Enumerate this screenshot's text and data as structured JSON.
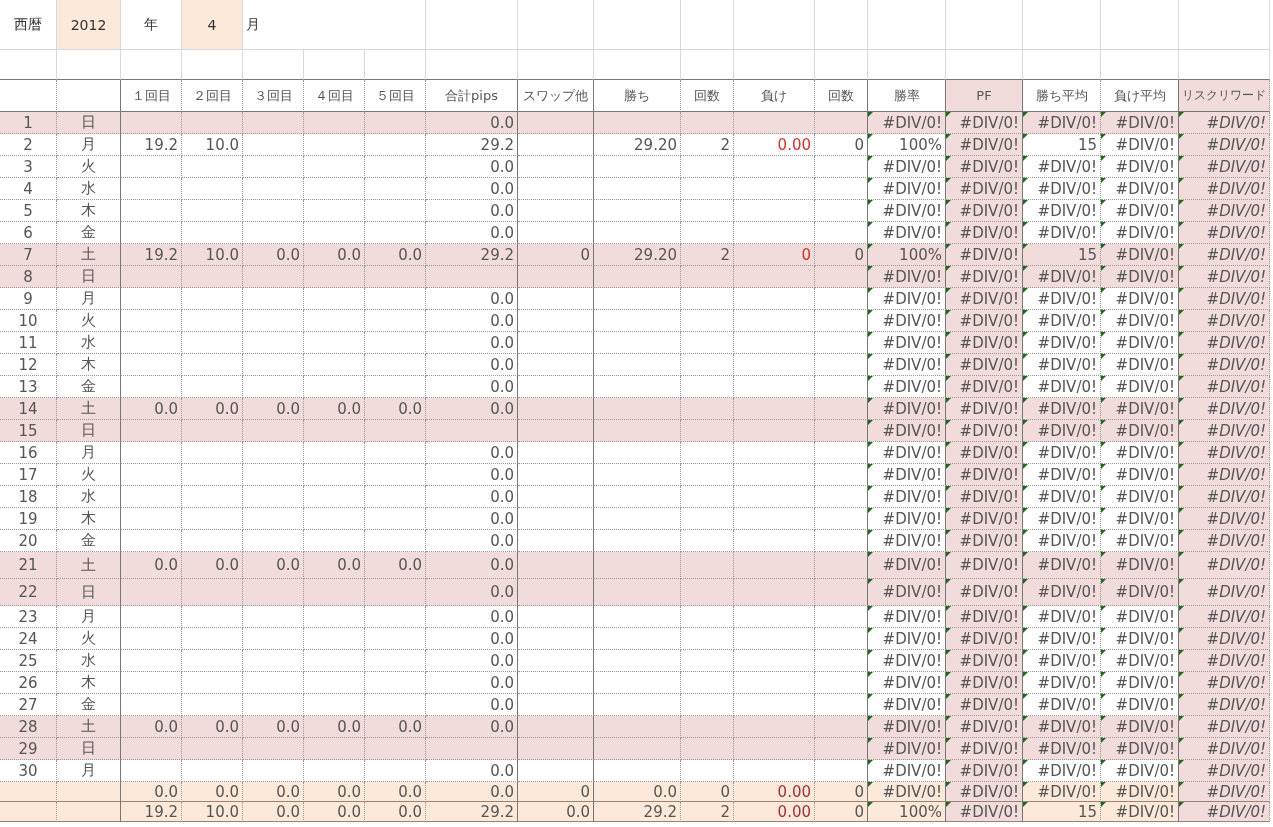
{
  "top": {
    "era_label": "西暦",
    "year": "2012",
    "year_label": "年",
    "month": "4",
    "month_label": "月"
  },
  "columns": [
    "",
    "",
    "１回目",
    "２回目",
    "３回目",
    "４回目",
    "５回目",
    "合計pips",
    "スワップ他",
    "勝ち",
    "回数",
    "負け",
    "回数",
    "勝率",
    "PF",
    "勝ち平均",
    "負け平均",
    "リスクリワード"
  ],
  "rows": [
    {
      "day": "1",
      "weekday": "日",
      "weekend": true,
      "cells": [
        "",
        "",
        "",
        "",
        "",
        "0.0",
        "",
        "",
        "",
        "",
        "",
        "#DIV/0!",
        "#DIV/0!",
        "#DIV/0!",
        "#DIV/0!",
        "#DIV/0!"
      ]
    },
    {
      "day": "2",
      "weekday": "月",
      "weekend": false,
      "cells": [
        "19.2",
        "10.0",
        "",
        "",
        "",
        "29.2",
        "",
        "29.20",
        "2",
        "0.00",
        "0",
        "100%",
        "#DIV/0!",
        "15",
        "#DIV/0!",
        "#DIV/0!"
      ]
    },
    {
      "day": "3",
      "weekday": "火",
      "weekend": false,
      "cells": [
        "",
        "",
        "",
        "",
        "",
        "0.0",
        "",
        "",
        "",
        "",
        "",
        "#DIV/0!",
        "#DIV/0!",
        "#DIV/0!",
        "#DIV/0!",
        "#DIV/0!"
      ]
    },
    {
      "day": "4",
      "weekday": "水",
      "weekend": false,
      "cells": [
        "",
        "",
        "",
        "",
        "",
        "0.0",
        "",
        "",
        "",
        "",
        "",
        "#DIV/0!",
        "#DIV/0!",
        "#DIV/0!",
        "#DIV/0!",
        "#DIV/0!"
      ]
    },
    {
      "day": "5",
      "weekday": "木",
      "weekend": false,
      "cells": [
        "",
        "",
        "",
        "",
        "",
        "0.0",
        "",
        "",
        "",
        "",
        "",
        "#DIV/0!",
        "#DIV/0!",
        "#DIV/0!",
        "#DIV/0!",
        "#DIV/0!"
      ]
    },
    {
      "day": "6",
      "weekday": "金",
      "weekend": false,
      "cells": [
        "",
        "",
        "",
        "",
        "",
        "0.0",
        "",
        "",
        "",
        "",
        "",
        "#DIV/0!",
        "#DIV/0!",
        "#DIV/0!",
        "#DIV/0!",
        "#DIV/0!"
      ]
    },
    {
      "day": "7",
      "weekday": "土",
      "weekend": true,
      "cells": [
        "19.2",
        "10.0",
        "0.0",
        "0.0",
        "0.0",
        "29.2",
        "0",
        "29.20",
        "2",
        "0",
        "0",
        "100%",
        "#DIV/0!",
        "15",
        "#DIV/0!",
        "#DIV/0!"
      ]
    },
    {
      "day": "8",
      "weekday": "日",
      "weekend": true,
      "cells": [
        "",
        "",
        "",
        "",
        "",
        "",
        "",
        "",
        "",
        "",
        "",
        "#DIV/0!",
        "#DIV/0!",
        "#DIV/0!",
        "#DIV/0!",
        "#DIV/0!"
      ]
    },
    {
      "day": "9",
      "weekday": "月",
      "weekend": false,
      "cells": [
        "",
        "",
        "",
        "",
        "",
        "0.0",
        "",
        "",
        "",
        "",
        "",
        "#DIV/0!",
        "#DIV/0!",
        "#DIV/0!",
        "#DIV/0!",
        "#DIV/0!"
      ]
    },
    {
      "day": "10",
      "weekday": "火",
      "weekend": false,
      "cells": [
        "",
        "",
        "",
        "",
        "",
        "0.0",
        "",
        "",
        "",
        "",
        "",
        "#DIV/0!",
        "#DIV/0!",
        "#DIV/0!",
        "#DIV/0!",
        "#DIV/0!"
      ]
    },
    {
      "day": "11",
      "weekday": "水",
      "weekend": false,
      "cells": [
        "",
        "",
        "",
        "",
        "",
        "0.0",
        "",
        "",
        "",
        "",
        "",
        "#DIV/0!",
        "#DIV/0!",
        "#DIV/0!",
        "#DIV/0!",
        "#DIV/0!"
      ]
    },
    {
      "day": "12",
      "weekday": "木",
      "weekend": false,
      "cells": [
        "",
        "",
        "",
        "",
        "",
        "0.0",
        "",
        "",
        "",
        "",
        "",
        "#DIV/0!",
        "#DIV/0!",
        "#DIV/0!",
        "#DIV/0!",
        "#DIV/0!"
      ]
    },
    {
      "day": "13",
      "weekday": "金",
      "weekend": false,
      "cells": [
        "",
        "",
        "",
        "",
        "",
        "0.0",
        "",
        "",
        "",
        "",
        "",
        "#DIV/0!",
        "#DIV/0!",
        "#DIV/0!",
        "#DIV/0!",
        "#DIV/0!"
      ]
    },
    {
      "day": "14",
      "weekday": "土",
      "weekend": true,
      "cells": [
        "0.0",
        "0.0",
        "0.0",
        "0.0",
        "0.0",
        "0.0",
        "",
        "",
        "",
        "",
        "",
        "#DIV/0!",
        "#DIV/0!",
        "#DIV/0!",
        "#DIV/0!",
        "#DIV/0!"
      ]
    },
    {
      "day": "15",
      "weekday": "日",
      "weekend": true,
      "cells": [
        "",
        "",
        "",
        "",
        "",
        "",
        "",
        "",
        "",
        "",
        "",
        "#DIV/0!",
        "#DIV/0!",
        "#DIV/0!",
        "#DIV/0!",
        "#DIV/0!"
      ]
    },
    {
      "day": "16",
      "weekday": "月",
      "weekend": false,
      "cells": [
        "",
        "",
        "",
        "",
        "",
        "0.0",
        "",
        "",
        "",
        "",
        "",
        "#DIV/0!",
        "#DIV/0!",
        "#DIV/0!",
        "#DIV/0!",
        "#DIV/0!"
      ]
    },
    {
      "day": "17",
      "weekday": "火",
      "weekend": false,
      "cells": [
        "",
        "",
        "",
        "",
        "",
        "0.0",
        "",
        "",
        "",
        "",
        "",
        "#DIV/0!",
        "#DIV/0!",
        "#DIV/0!",
        "#DIV/0!",
        "#DIV/0!"
      ]
    },
    {
      "day": "18",
      "weekday": "水",
      "weekend": false,
      "cells": [
        "",
        "",
        "",
        "",
        "",
        "0.0",
        "",
        "",
        "",
        "",
        "",
        "#DIV/0!",
        "#DIV/0!",
        "#DIV/0!",
        "#DIV/0!",
        "#DIV/0!"
      ]
    },
    {
      "day": "19",
      "weekday": "木",
      "weekend": false,
      "cells": [
        "",
        "",
        "",
        "",
        "",
        "0.0",
        "",
        "",
        "",
        "",
        "",
        "#DIV/0!",
        "#DIV/0!",
        "#DIV/0!",
        "#DIV/0!",
        "#DIV/0!"
      ]
    },
    {
      "day": "20",
      "weekday": "金",
      "weekend": false,
      "cells": [
        "",
        "",
        "",
        "",
        "",
        "0.0",
        "",
        "",
        "",
        "",
        "",
        "#DIV/0!",
        "#DIV/0!",
        "#DIV/0!",
        "#DIV/0!",
        "#DIV/0!"
      ]
    },
    {
      "day": "21",
      "weekday": "土",
      "weekend": true,
      "cells": [
        "0.0",
        "0.0",
        "0.0",
        "0.0",
        "0.0",
        "0.0",
        "",
        "",
        "",
        "",
        "",
        "#DIV/0!",
        "#DIV/0!",
        "#DIV/0!",
        "#DIV/0!",
        "#DIV/0!"
      ]
    },
    {
      "day": "22",
      "weekday": "日",
      "weekend": true,
      "cells": [
        "",
        "",
        "",
        "",
        "",
        "0.0",
        "",
        "",
        "",
        "",
        "",
        "#DIV/0!",
        "#DIV/0!",
        "#DIV/0!",
        "#DIV/0!",
        "#DIV/0!"
      ]
    },
    {
      "day": "23",
      "weekday": "月",
      "weekend": false,
      "cells": [
        "",
        "",
        "",
        "",
        "",
        "0.0",
        "",
        "",
        "",
        "",
        "",
        "#DIV/0!",
        "#DIV/0!",
        "#DIV/0!",
        "#DIV/0!",
        "#DIV/0!"
      ]
    },
    {
      "day": "24",
      "weekday": "火",
      "weekend": false,
      "cells": [
        "",
        "",
        "",
        "",
        "",
        "0.0",
        "",
        "",
        "",
        "",
        "",
        "#DIV/0!",
        "#DIV/0!",
        "#DIV/0!",
        "#DIV/0!",
        "#DIV/0!"
      ]
    },
    {
      "day": "25",
      "weekday": "水",
      "weekend": false,
      "cells": [
        "",
        "",
        "",
        "",
        "",
        "0.0",
        "",
        "",
        "",
        "",
        "",
        "#DIV/0!",
        "#DIV/0!",
        "#DIV/0!",
        "#DIV/0!",
        "#DIV/0!"
      ]
    },
    {
      "day": "26",
      "weekday": "木",
      "weekend": false,
      "cells": [
        "",
        "",
        "",
        "",
        "",
        "0.0",
        "",
        "",
        "",
        "",
        "",
        "#DIV/0!",
        "#DIV/0!",
        "#DIV/0!",
        "#DIV/0!",
        "#DIV/0!"
      ]
    },
    {
      "day": "27",
      "weekday": "金",
      "weekend": false,
      "cells": [
        "",
        "",
        "",
        "",
        "",
        "0.0",
        "",
        "",
        "",
        "",
        "",
        "#DIV/0!",
        "#DIV/0!",
        "#DIV/0!",
        "#DIV/0!",
        "#DIV/0!"
      ]
    },
    {
      "day": "28",
      "weekday": "土",
      "weekend": true,
      "cells": [
        "0.0",
        "0.0",
        "0.0",
        "0.0",
        "0.0",
        "0.0",
        "",
        "",
        "",
        "",
        "",
        "#DIV/0!",
        "#DIV/0!",
        "#DIV/0!",
        "#DIV/0!",
        "#DIV/0!"
      ]
    },
    {
      "day": "29",
      "weekday": "日",
      "weekend": true,
      "cells": [
        "",
        "",
        "",
        "",
        "",
        "",
        "",
        "",
        "",
        "",
        "",
        "#DIV/0!",
        "#DIV/0!",
        "#DIV/0!",
        "#DIV/0!",
        "#DIV/0!"
      ]
    },
    {
      "day": "30",
      "weekday": "月",
      "weekend": false,
      "cells": [
        "",
        "",
        "",
        "",
        "",
        "0.0",
        "",
        "",
        "",
        "",
        "",
        "#DIV/0!",
        "#DIV/0!",
        "#DIV/0!",
        "#DIV/0!",
        "#DIV/0!"
      ]
    }
  ],
  "totals": [
    {
      "cells": [
        "0.0",
        "0.0",
        "0.0",
        "0.0",
        "0.0",
        "0.0",
        "0",
        "0.0",
        "0",
        "0.00",
        "0",
        "#DIV/0!",
        "#DIV/0!",
        "#DIV/0!",
        "#DIV/0!",
        "#DIV/0!"
      ]
    },
    {
      "cells": [
        "19.2",
        "10.0",
        "0.0",
        "0.0",
        "0.0",
        "29.2",
        "0.0",
        "29.2",
        "2",
        "0.00",
        "0",
        "100%",
        "#DIV/0!",
        "15",
        "#DIV/0!",
        "#DIV/0!"
      ]
    }
  ]
}
